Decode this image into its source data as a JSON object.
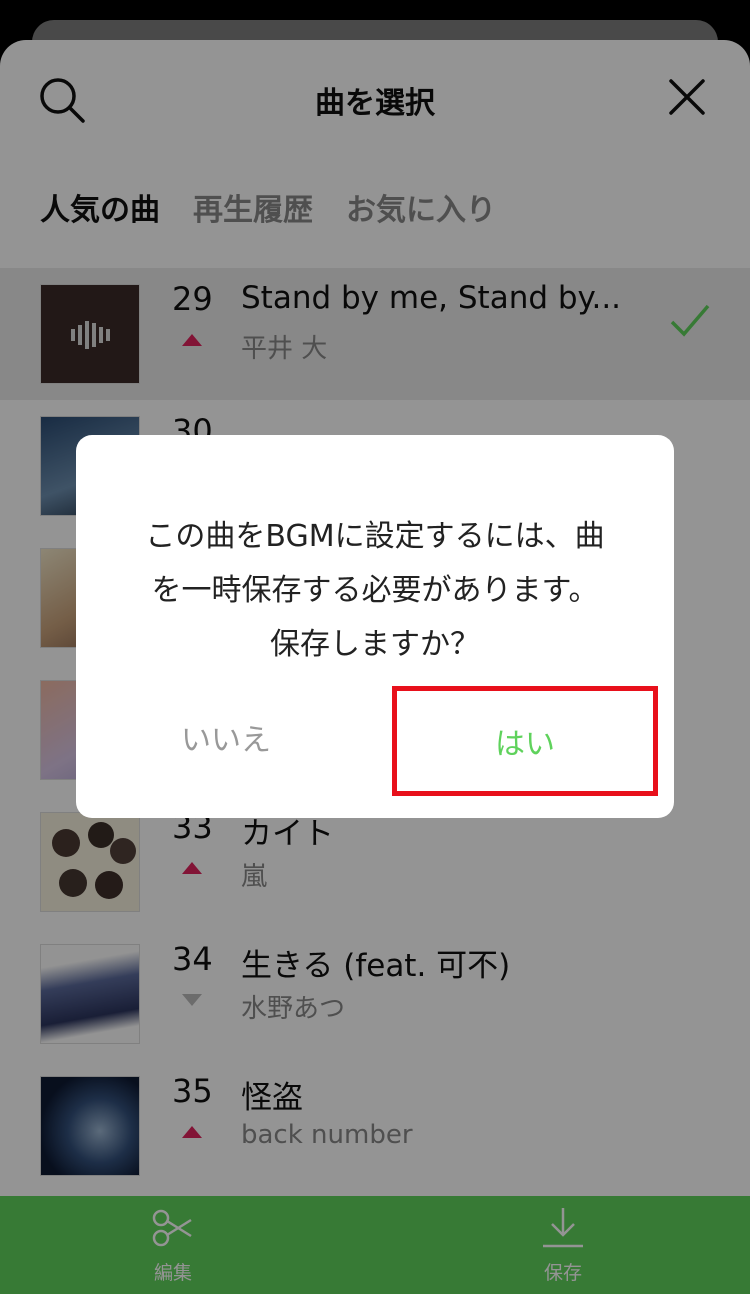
{
  "header": {
    "title": "曲を選択"
  },
  "tabs": [
    "人気の曲",
    "再生履歴",
    "お気に入り"
  ],
  "songs": [
    {
      "rank": "29",
      "title": "Stand by me, Stand by...",
      "artist": "平井 大",
      "trend": "up",
      "selected": true
    },
    {
      "rank": "33",
      "title": "カイト",
      "artist": "嵐",
      "trend": "up"
    },
    {
      "rank": "34",
      "title": "生きる (feat. 可不)",
      "artist": "水野あつ",
      "trend": "down"
    },
    {
      "rank": "35",
      "title": "怪盗",
      "artist": "back number",
      "trend": "up"
    }
  ],
  "partial_row": {
    "rank": "30"
  },
  "bottom_bar": {
    "edit_label": "編集",
    "save_label": "保存"
  },
  "dialog": {
    "line1": "この曲をBGMに設定するには、曲",
    "line2": "を一時保存する必要があります。",
    "line3": "保存しますか？",
    "no_label": "いいえ",
    "yes_label": "はい"
  },
  "colors": {
    "accent_green": "#5fd25c",
    "trend_up": "#e0245e",
    "highlight_red": "#e8101b"
  }
}
